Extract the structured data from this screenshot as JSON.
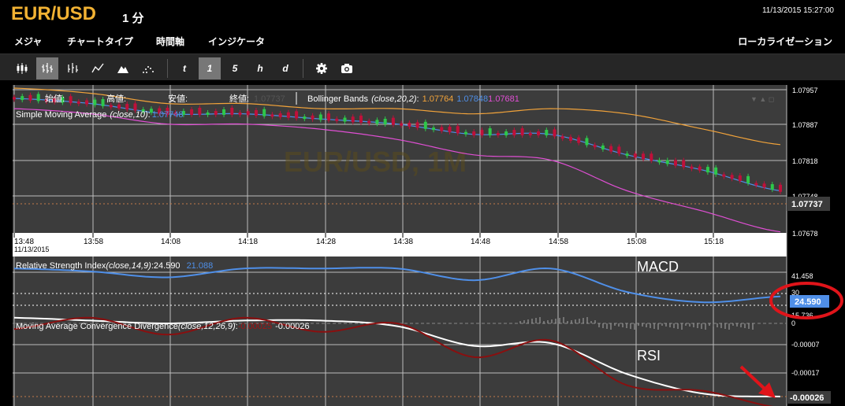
{
  "header": {
    "pair": "EUR/USD",
    "period": "1 分",
    "datetime": "11/13/2015 15:27:00"
  },
  "menu": {
    "items": [
      "メジャ",
      "チャートタイプ",
      "時間軸",
      "インジケータ"
    ],
    "right": "ローカライゼーション"
  },
  "toolbar": {
    "time_buttons": [
      "t",
      "1",
      "5",
      "h",
      "d"
    ],
    "active": "1",
    "icons": [
      "candlestick-icon",
      "ohlc-bar-icon",
      "hlc-bar-icon",
      "line-chart-icon",
      "mountain-chart-icon",
      "dot-chart-icon",
      "settings-icon",
      "camera-icon"
    ]
  },
  "main_panel": {
    "ohlc": {
      "open_label": "始値:",
      "high_label": "高値:",
      "low_label": "安値:",
      "close_label": "終値:",
      "close_value": "1.07737"
    },
    "bollinger": {
      "label": "Bollinger Bands",
      "params": "(close,20,2)",
      "sep": ":",
      "upper": "1.07764",
      "mid": "1.07848",
      "lower": "1.07681",
      "upper_color": "#f2a33a",
      "mid_color": "#4f8fe8",
      "lower_color": "#e04fd4"
    },
    "sma": {
      "label": "Simple Moving Average",
      "params": "(close,10)",
      "sep": ":",
      "value": "1.07748"
    },
    "watermark": "EUR/USD, 1M",
    "price_ticks": [
      "1.07957",
      "1.07887",
      "1.07818",
      "1.07748",
      "1.07678"
    ],
    "current_price": "1.07737",
    "time_ticks": [
      "13:48",
      "13:58",
      "14:08",
      "14:18",
      "14:28",
      "14:38",
      "14:48",
      "14:58",
      "15:08",
      "15:18"
    ],
    "date_label": "11/13/2015"
  },
  "rsi_panel": {
    "label": "Relative Strength Index",
    "params": "(close,14,9)",
    "sep": ":",
    "value1": "24.590",
    "value2": "21.088",
    "ticks": [
      "41.458",
      "30",
      "15.736"
    ],
    "current": "24.590",
    "annotation": "MACD"
  },
  "macd_panel": {
    "label": "Moving Average Convergence Divergence",
    "params": "(close,12,26,9)",
    "sep": ":",
    "value1": "-0.00025",
    "value2": "-0.00026",
    "ticks": [
      "0",
      "-0.00007",
      "-0.00017"
    ],
    "current": "-0.00026",
    "annotation": "RSI"
  },
  "chart_data": {
    "type": "line",
    "x": [
      "13:48",
      "13:58",
      "14:08",
      "14:18",
      "14:28",
      "14:38",
      "14:48",
      "14:58",
      "15:08",
      "15:18",
      "15:27"
    ],
    "series": [
      {
        "name": "Bollinger Bands upper",
        "values": [
          1.0796,
          1.0795,
          1.0793,
          1.0793,
          1.0792,
          1.0792,
          1.0791,
          1.0792,
          1.0791,
          1.0788,
          1.0785
        ]
      },
      {
        "name": "Bollinger Bands mid",
        "values": [
          1.0794,
          1.0793,
          1.0791,
          1.0791,
          1.079,
          1.0789,
          1.0787,
          1.0787,
          1.0783,
          1.078,
          1.0776
        ]
      },
      {
        "name": "Bollinger Bands lower",
        "values": [
          1.0792,
          1.0791,
          1.0789,
          1.0789,
          1.0788,
          1.0786,
          1.0783,
          1.0782,
          1.0776,
          1.0772,
          1.0768
        ]
      },
      {
        "name": "Relative Strength Index",
        "values": [
          45,
          42,
          38,
          47,
          50,
          45,
          36,
          45,
          28,
          21,
          25
        ]
      },
      {
        "name": "MACD",
        "values": [
          2e-05,
          1e-05,
          0.0,
          1e-05,
          1e-05,
          -1e-05,
          -8e-05,
          -7e-05,
          -0.00018,
          -0.00025,
          -0.00026
        ]
      }
    ],
    "ylim": [
      1.07678,
      1.07957
    ]
  }
}
